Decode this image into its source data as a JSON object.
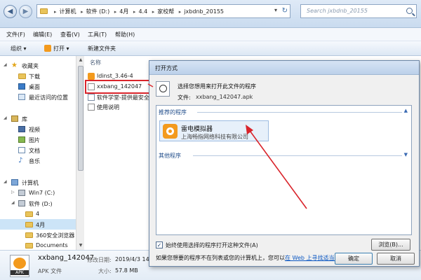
{
  "colors": {
    "accent": "#d9242b",
    "selection": "#cce4f7",
    "app_orange": "#f39a1d",
    "link": "#0b57c2"
  },
  "address": {
    "crumbs": [
      "计算机",
      "软件 (D:)",
      "4月",
      "4.4",
      "家校帮",
      "jxbdnb_20155"
    ],
    "search_placeholder": "Search jxbdnb_20155"
  },
  "menu": [
    "文件(F)",
    "编辑(E)",
    "查看(V)",
    "工具(T)",
    "帮助(H)"
  ],
  "toolbar": {
    "organize": "组织 ▾",
    "open": "打开 ▾",
    "new_folder": "新建文件夹"
  },
  "nav": {
    "favorites": "收藏夹",
    "downloads": "下载",
    "desktop": "桌面",
    "recent": "最近访问的位置",
    "library": "库",
    "video": "视频",
    "pictures": "图片",
    "documents": "文档",
    "music": "音乐",
    "computer": "计算机",
    "win7": "Win7 (C:)",
    "soft": "软件 (D:)",
    "april4": "4",
    "april": "4月",
    "safe": "360安全浏览器",
    "docs": "Documents"
  },
  "files": {
    "column": "名称",
    "items": [
      "ldinst_3.46-4",
      "xxbang_142047",
      "软件学堂-提供最安全",
      "使用说明"
    ]
  },
  "details": {
    "name": "xxbang_142047",
    "type": "APK 文件",
    "thumb_label": "APK",
    "modified_key": "修改日期:",
    "modified_val": "2019/4/3 14",
    "size_key": "大小:",
    "size_val": "57.8 MB"
  },
  "dialog": {
    "title": "打开方式",
    "prompt": "选择您想用来打开此文件的程序",
    "file_label": "文件:",
    "file_value": "xxbang_142047.apk",
    "recommended": "推荐的程序",
    "program_name": "雷电模拟器",
    "program_vendor": "上海畅指网络科技有限公司",
    "other": "其他程序",
    "always_label": "始终使用选择的程序打开这种文件(A)",
    "browse": "浏览(B)...",
    "help_text": "如果您想要的程序不在列表或您的计算机上，您可以",
    "help_link": "在 Web 上寻找适当的程序",
    "ok": "确定",
    "cancel": "取消"
  }
}
